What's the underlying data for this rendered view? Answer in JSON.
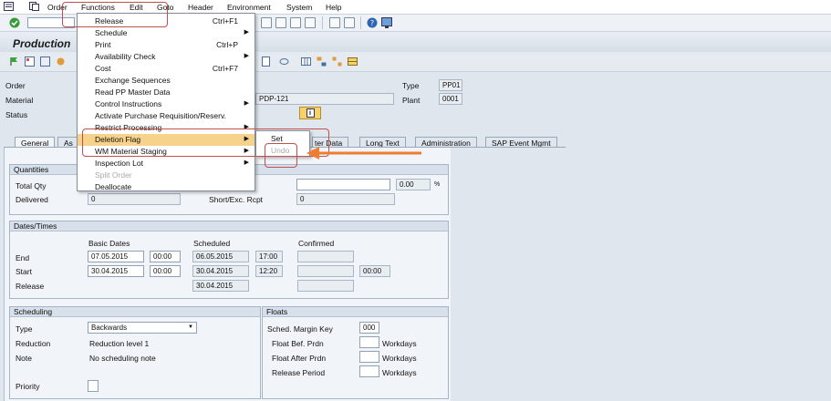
{
  "menubar": {
    "items": [
      "Order",
      "Functions",
      "Edit",
      "Goto",
      "Header",
      "Environment",
      "System",
      "Help"
    ]
  },
  "title": "Production",
  "header": {
    "order_label": "Order",
    "material_label": "Material",
    "status_label": "Status",
    "material_value": "PDP-121",
    "type_label": "Type",
    "type_value": "PP01",
    "plant_label": "Plant",
    "plant_value": "0001",
    "info_icon": "i"
  },
  "tabs": [
    "General",
    "As",
    "ter Data",
    "Long Text",
    "Administration",
    "SAP Event Mgmt"
  ],
  "quantities": {
    "title": "Quantities",
    "total_qty_label": "Total Qty",
    "delivered_label": "Delivered",
    "delivered_value": "0",
    "short_exc_label": "Short/Exc. Rcpt",
    "short_exc_value": "0",
    "pct_value": "0.00",
    "pct_unit": "%"
  },
  "dates": {
    "title": "Dates/Times",
    "col_basic": "Basic Dates",
    "col_scheduled": "Scheduled",
    "col_confirmed": "Confirmed",
    "end_label": "End",
    "start_label": "Start",
    "release_label": "Release",
    "end_basic": "07.05.2015",
    "end_basic_time": "00:00",
    "end_sched": "06.05.2015",
    "end_sched_time": "17:00",
    "start_basic": "30.04.2015",
    "start_basic_time": "00:00",
    "start_sched": "30.04.2015",
    "start_sched_time": "12:20",
    "start_conf_time": "00:00",
    "release_sched": "30.04.2015"
  },
  "scheduling": {
    "title": "Scheduling",
    "type_label": "Type",
    "type_value": "Backwards",
    "reduction_label": "Reduction",
    "reduction_value": "Reduction level 1",
    "note_label": "Note",
    "note_value": "No scheduling note",
    "priority_label": "Priority"
  },
  "floats": {
    "title": "Floats",
    "margin_key_label": "Sched. Margin Key",
    "margin_key_value": "000",
    "float_before_label": "Float Bef. Prdn",
    "float_after_label": "Float After Prdn",
    "release_period_label": "Release Period",
    "unit": "Workdays"
  },
  "functions_menu": {
    "items": [
      {
        "label": "Release",
        "shortcut": "Ctrl+F1",
        "submenu": false,
        "disabled": false
      },
      {
        "label": "Schedule",
        "shortcut": "",
        "submenu": true,
        "disabled": false
      },
      {
        "label": "Print",
        "shortcut": "Ctrl+P",
        "submenu": false,
        "disabled": false
      },
      {
        "label": "Availability Check",
        "shortcut": "",
        "submenu": true,
        "disabled": false
      },
      {
        "label": "Cost",
        "shortcut": "Ctrl+F7",
        "submenu": false,
        "disabled": false
      },
      {
        "label": "Exchange Sequences",
        "shortcut": "",
        "submenu": false,
        "disabled": false
      },
      {
        "label": "Read PP Master Data",
        "shortcut": "",
        "submenu": false,
        "disabled": false
      },
      {
        "label": "Control Instructions",
        "shortcut": "",
        "submenu": true,
        "disabled": false
      },
      {
        "label": "Activate Purchase Requisition/Reserv.",
        "shortcut": "",
        "submenu": false,
        "disabled": false
      },
      {
        "label": "Restrict Processing",
        "shortcut": "",
        "submenu": true,
        "disabled": false
      },
      {
        "label": "Deletion Flag",
        "shortcut": "",
        "submenu": true,
        "disabled": false
      },
      {
        "label": "WM Material Staging",
        "shortcut": "",
        "submenu": true,
        "disabled": false
      },
      {
        "label": "Inspection Lot",
        "shortcut": "",
        "submenu": true,
        "disabled": false
      },
      {
        "label": "Split Order",
        "shortcut": "",
        "submenu": false,
        "disabled": true
      },
      {
        "label": "Deallocate",
        "shortcut": "",
        "submenu": false,
        "disabled": false
      }
    ]
  },
  "deletion_submenu": {
    "items": [
      {
        "label": "Set",
        "disabled": false
      },
      {
        "label": "Undo",
        "disabled": true
      }
    ]
  },
  "colors": {
    "highlight": "#f7d28a",
    "annotation_red": "#c0504d",
    "annotation_arrow": "#ed7d31"
  }
}
